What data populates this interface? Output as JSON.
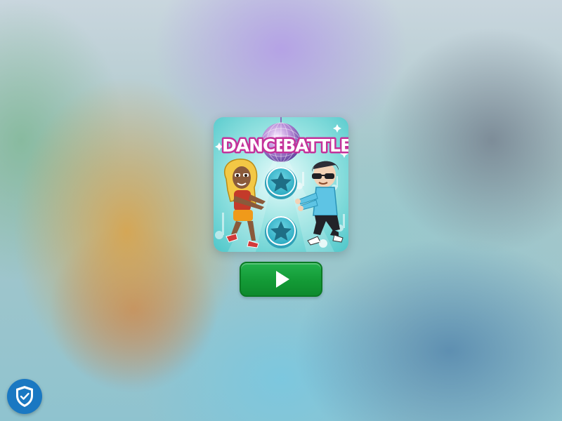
{
  "game": {
    "title_part1": "DANCE",
    "title_part2": "BATTLE",
    "thumbnail_accent": "#4cc6c9",
    "title_color": "#ffffff",
    "title_outline": "#c4329a"
  },
  "play_button": {
    "icon": "play-icon",
    "color": "#139a36"
  },
  "privacy_button": {
    "icon": "shield-check-icon",
    "color": "#1a78c2"
  }
}
